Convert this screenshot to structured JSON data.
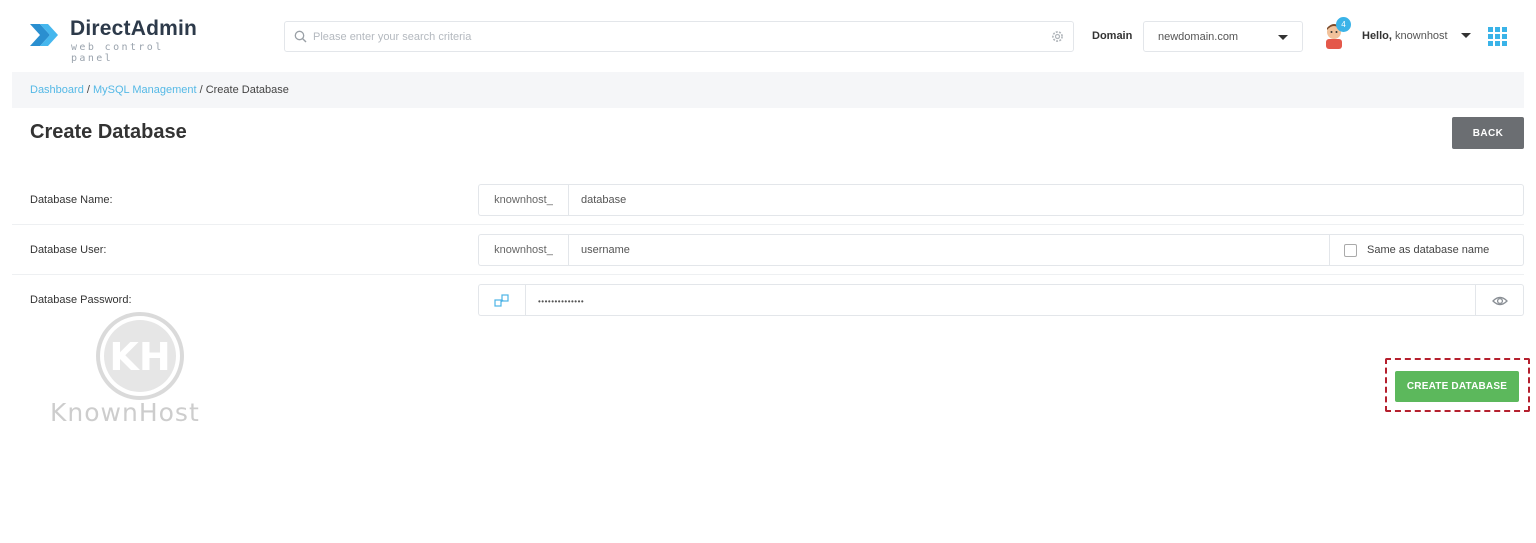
{
  "brand": {
    "title": "DirectAdmin",
    "subtitle": "web control panel",
    "icon": "directadmin-chevron-logo",
    "accent_color": "#1e9fd9"
  },
  "header": {
    "search_placeholder": "Please enter your search criteria",
    "domain_label": "Domain",
    "domain_value": "newdomain.com",
    "notification_count": "4",
    "hello_label": "Hello,",
    "username": "knownhost"
  },
  "breadcrumb": {
    "items": [
      "Dashboard",
      "MySQL Management"
    ],
    "separator": " / ",
    "current": "Create Database"
  },
  "page": {
    "title": "Create Database",
    "back_label": "BACK"
  },
  "form": {
    "db_name": {
      "label": "Database Name:",
      "prefix": "knownhost_",
      "value": "database"
    },
    "db_user": {
      "label": "Database User:",
      "prefix": "knownhost_",
      "value": "username",
      "same_as_label": "Same as database name",
      "same_as_checked": false
    },
    "db_password": {
      "label": "Database Password:",
      "value": "••••••••••••••",
      "generate_icon": "key-generate-icon",
      "toggle_icon": "eye-icon"
    },
    "submit_label": "CREATE DATABASE",
    "submit_color": "#5cb85c",
    "highlight_color": "#b5202e"
  },
  "watermark": {
    "text": "KnownHost",
    "monogram": "KH"
  }
}
